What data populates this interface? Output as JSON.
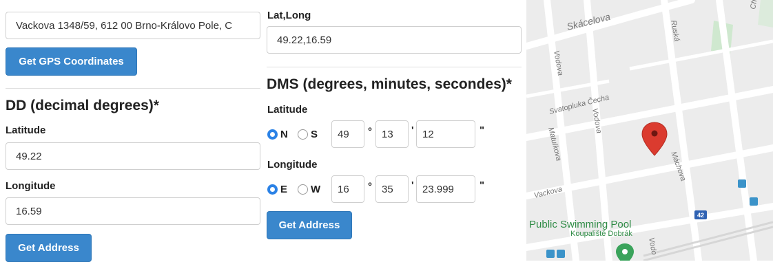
{
  "address": {
    "value": "Vackova 1348/59, 612 00 Brno-Královo Pole, C",
    "button_label": "Get GPS Coordinates"
  },
  "latlong": {
    "label": "Lat,Long",
    "value": "49.22,16.59"
  },
  "dd": {
    "heading": "DD (decimal degrees)*",
    "latitude_label": "Latitude",
    "latitude_value": "49.22",
    "longitude_label": "Longitude",
    "longitude_value": "16.59",
    "button_label": "Get Address"
  },
  "dms": {
    "heading": "DMS (degrees, minutes, secondes)*",
    "latitude_label": "Latitude",
    "lat_dir_n": "N",
    "lat_dir_s": "S",
    "lat_selected": "N",
    "lat_deg": "49",
    "lat_min": "13",
    "lat_sec": "12",
    "longitude_label": "Longitude",
    "lon_dir_e": "E",
    "lon_dir_w": "W",
    "lon_selected": "E",
    "lon_deg": "16",
    "lon_min": "35",
    "lon_sec": "23.999",
    "deg_symbol": "°",
    "min_symbol": "'",
    "sec_symbol": "\"",
    "button_label": "Get Address"
  },
  "map": {
    "streets": {
      "skacelova": "Skácelova",
      "ruska": "Ruská",
      "charva": "Charva",
      "vodova_top": "Vodova",
      "svatopluka": "Svatopluka Čecha",
      "vodova_mid": "Vodova",
      "matulkova": "Matulkova",
      "machova": "Máchova",
      "vackova": "Vackova",
      "vodova_bottom": "Vodo"
    },
    "route_shield": "42",
    "poi_name": "Public Swimming Pool",
    "poi_subname": "Koupaliště Dobrák",
    "marker_icon": "map-pin-icon",
    "poi_icon": "pool-pin-icon",
    "colors": {
      "marker": "#db3b2f",
      "poi": "#3aa35b",
      "road": "#ffffff",
      "background": "#ececec",
      "shield": "#2f62b3",
      "transit": "#3b93c9"
    }
  }
}
